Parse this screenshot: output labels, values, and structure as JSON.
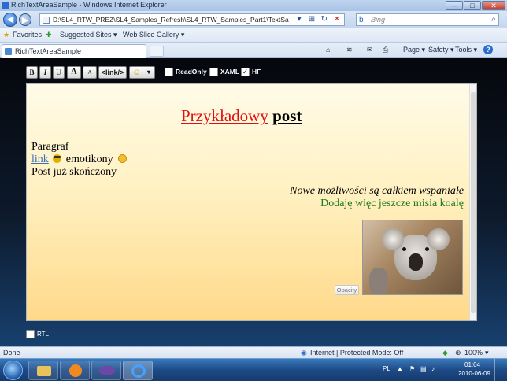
{
  "window": {
    "title": "RichTextAreaSample - Windows Internet Explorer",
    "minimize": "–",
    "maximize": "□",
    "close": "✕"
  },
  "nav": {
    "address": "D:\\SL4_RTW_PREZ\\SL4_Samples_Refresh\\SL4_RTW_Samples_Part1\\TextSamples\\RichText\\RichTextArea",
    "search_placeholder": "Bing"
  },
  "favorites": {
    "label": "Favorites",
    "suggested": "Suggested Sites ▾",
    "gallery": "Web Slice Gallery ▾"
  },
  "tabs": [
    {
      "label": "RichTextAreaSample"
    }
  ],
  "commands": {
    "page": "Page ▾",
    "safety": "Safety ▾",
    "tools": "Tools ▾",
    "help": "?"
  },
  "toolbar": {
    "bold": "B",
    "italic": "I",
    "underline": "U",
    "font_up": "A",
    "font_down": "A",
    "link": "<link/>",
    "emoticon": "☺",
    "dropdown": "▾",
    "checkboxes": [
      {
        "label": "ReadOnly",
        "checked": false
      },
      {
        "label": "XAML",
        "checked": false
      },
      {
        "label": "HF",
        "checked": true
      }
    ]
  },
  "editor": {
    "title_red": "Przykładowy",
    "title_black": "post",
    "line1": "Paragraf",
    "link": "link",
    "emoticons_text": "emotikony",
    "line3": "Post już skończony",
    "italic_line": "Nowe możliwości są całkiem wspaniałe",
    "green_line": "Dodaję więc jeszcze misia koalę",
    "opacity_button": "Opacity",
    "colors": {
      "title_red": "#e01010",
      "link": "#3a6fb0",
      "green": "#1c7a1c"
    }
  },
  "rtl": {
    "label": "RTL",
    "checked": false
  },
  "status": {
    "left": "Done",
    "zone": "Internet | Protected Mode: Off",
    "zoom": "100%"
  },
  "taskbar": {
    "lang": "PL",
    "time": "01:04",
    "date": "2010-06-09"
  }
}
